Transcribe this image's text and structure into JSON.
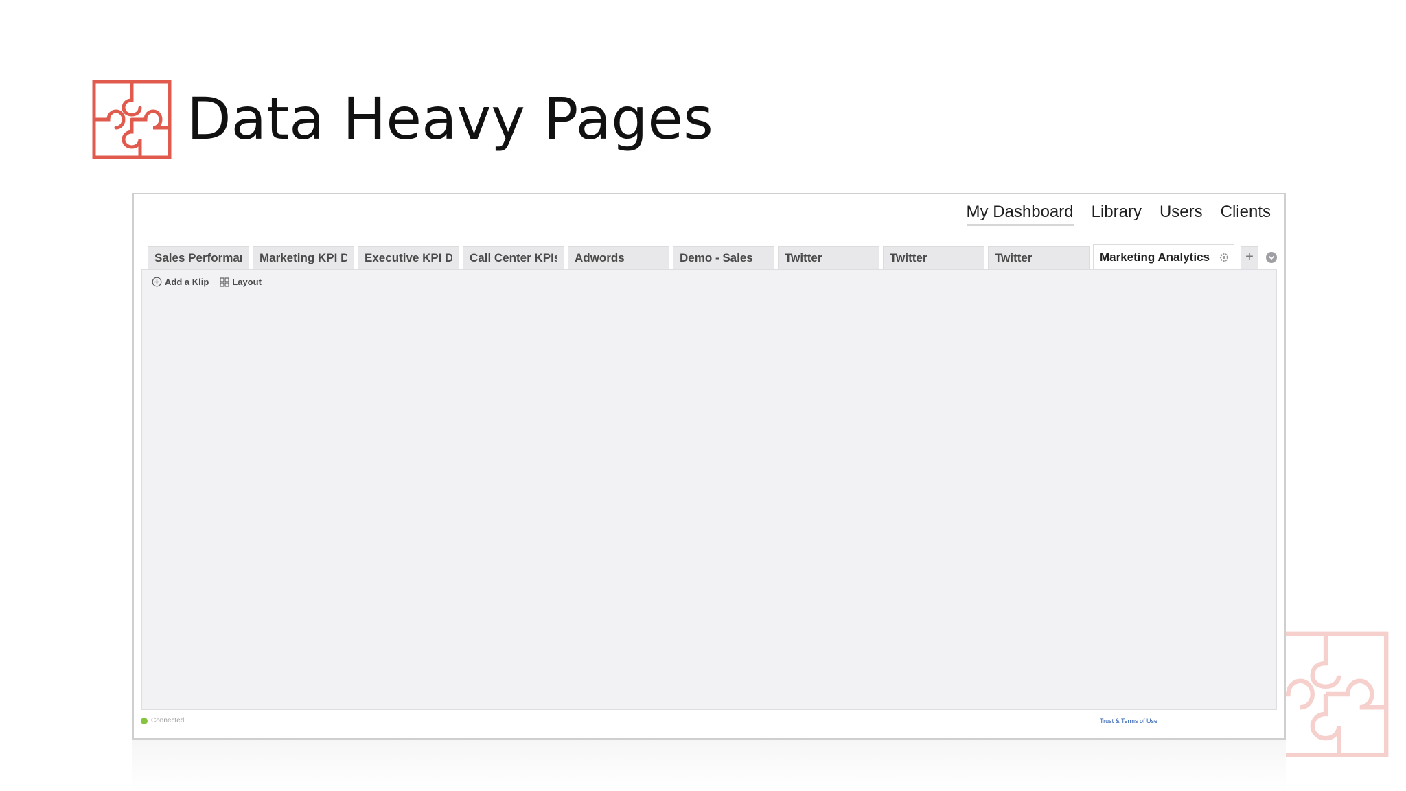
{
  "slide": {
    "title": "Data Heavy Pages",
    "accent_color": "#e05a4e",
    "logo_icon": "puzzle-icon"
  },
  "app": {
    "nav": [
      {
        "label": "My Dashboard",
        "active": true
      },
      {
        "label": "Library"
      },
      {
        "label": "Users"
      },
      {
        "label": "Clients"
      }
    ],
    "tabs": [
      {
        "label": "Sales Performance"
      },
      {
        "label": "Marketing KPI Dashboard"
      },
      {
        "label": "Executive KPI Dashboard"
      },
      {
        "label": "Call Center KPIs"
      },
      {
        "label": "Adwords"
      },
      {
        "label": "Demo - Sales"
      },
      {
        "label": "Twitter"
      },
      {
        "label": "Twitter"
      },
      {
        "label": "Twitter"
      },
      {
        "label": "Marketing Analytics",
        "active": true
      }
    ],
    "tab_icons": {
      "settings": "gear-icon",
      "add": "plus-icon",
      "menu": "chevron-down-circle-icon"
    },
    "toolbar": {
      "add_klip": "Add a Klip",
      "layout": "Layout"
    },
    "status": {
      "text": "Connected",
      "color": "#86c440"
    },
    "footer": {
      "link": "Trust & Terms of Use"
    }
  }
}
